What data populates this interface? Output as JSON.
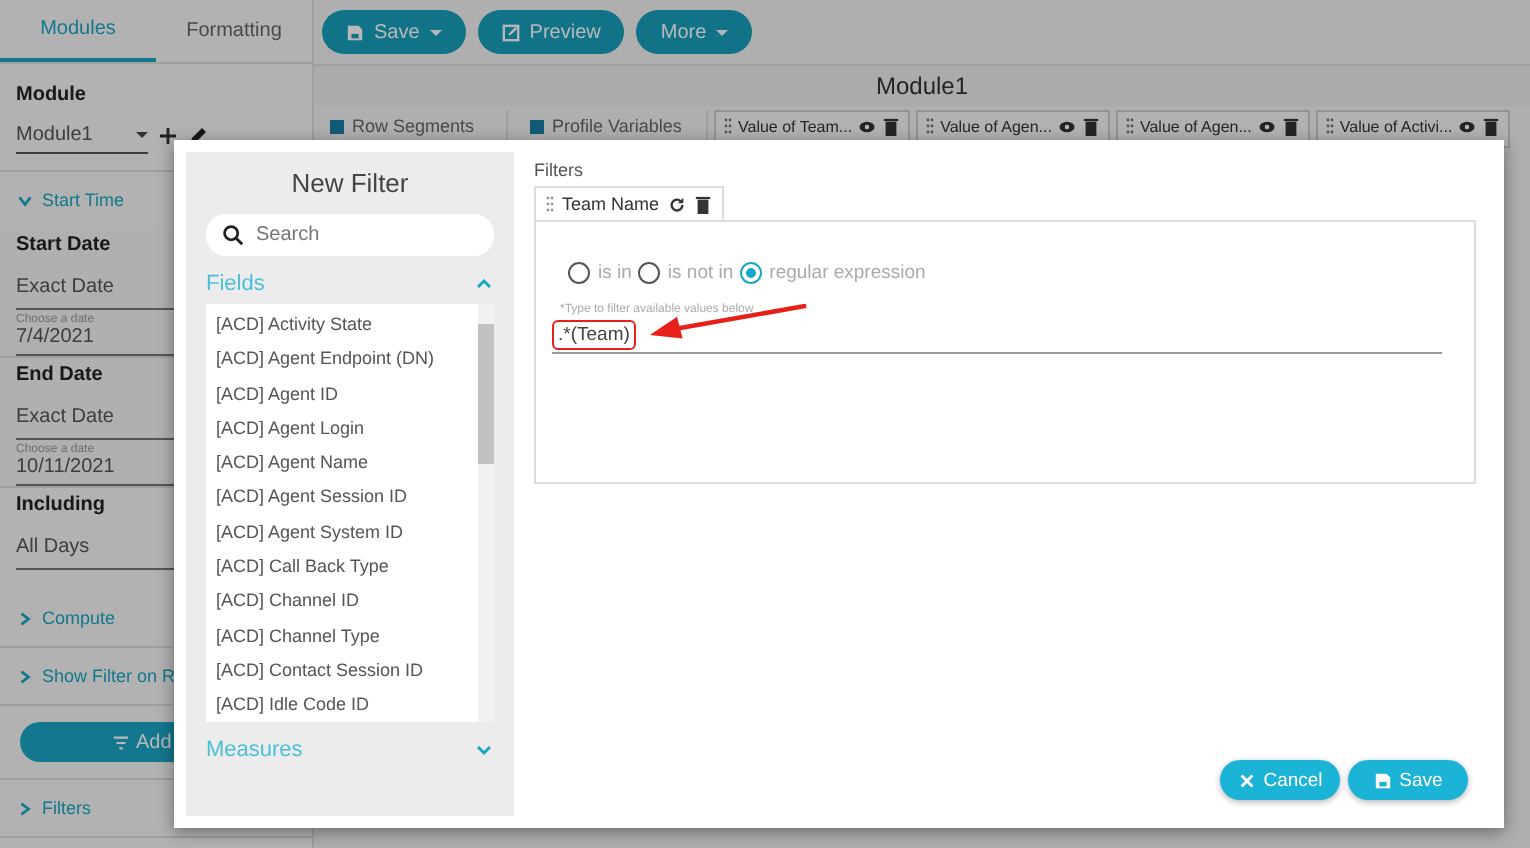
{
  "sidebar": {
    "tabs": [
      {
        "label": "Modules",
        "selected": true
      },
      {
        "label": "Formatting",
        "selected": false
      }
    ],
    "module": {
      "label": "Module",
      "value": "Module1"
    },
    "start_time": {
      "label": "Start Time",
      "expanded": true
    },
    "dates": [
      {
        "label": "Start Date",
        "mode": "Exact Date",
        "picker": {
          "hint": "Choose a date",
          "date": "7/4/2021"
        }
      },
      {
        "label": "End Date",
        "mode": "Exact Date",
        "picker": {
          "hint": "Choose a date",
          "date": "10/11/2021"
        }
      }
    ],
    "including": {
      "label": "Including",
      "value": "All Days"
    },
    "sections": [
      {
        "label": "Compute",
        "expanded": false
      },
      {
        "label": "Show Filter on R",
        "expanded": false
      }
    ],
    "add_button": "Add",
    "filters_section": {
      "label": "Filters",
      "expanded": false
    }
  },
  "toolbar": [
    {
      "label": "Save",
      "kind": "save"
    },
    {
      "label": "Preview",
      "kind": "preview"
    },
    {
      "label": "More",
      "kind": "more"
    }
  ],
  "module_title": "Module1",
  "segments": [
    "Row Segments",
    "Profile Variables"
  ],
  "columns": [
    "Value of Team...",
    "Value of Agen...",
    "Value of Agen...",
    "Value of Activi..."
  ],
  "dialog": {
    "title": "New Filter",
    "search": {
      "placeholder": "Search"
    },
    "groups": [
      {
        "label": "Fields",
        "expanded": true,
        "items": [
          "[ACD] Activity State",
          "[ACD] Agent Endpoint (DN)",
          "[ACD] Agent ID",
          "[ACD] Agent Login",
          "[ACD] Agent Name",
          "[ACD] Agent Session ID",
          "[ACD] Agent System ID",
          "[ACD] Call Back Type",
          "[ACD] Channel ID",
          "[ACD] Channel Type",
          "[ACD] Contact Session ID",
          "[ACD] Idle Code ID"
        ]
      },
      {
        "label": "Measures",
        "expanded": false
      }
    ],
    "filters_label": "Filters",
    "filter_tabs": [
      {
        "label": "Team Name",
        "selected": true
      }
    ],
    "options": [
      {
        "label": "is in",
        "selected": false
      },
      {
        "label": "is not in",
        "selected": false
      },
      {
        "label": "regular expression",
        "selected": true
      }
    ],
    "hint": "*Type to filter available values below",
    "value": ".*(Team)",
    "buttons": [
      {
        "label": "Cancel",
        "kind": "cancel"
      },
      {
        "label": "Save",
        "kind": "save"
      }
    ]
  }
}
